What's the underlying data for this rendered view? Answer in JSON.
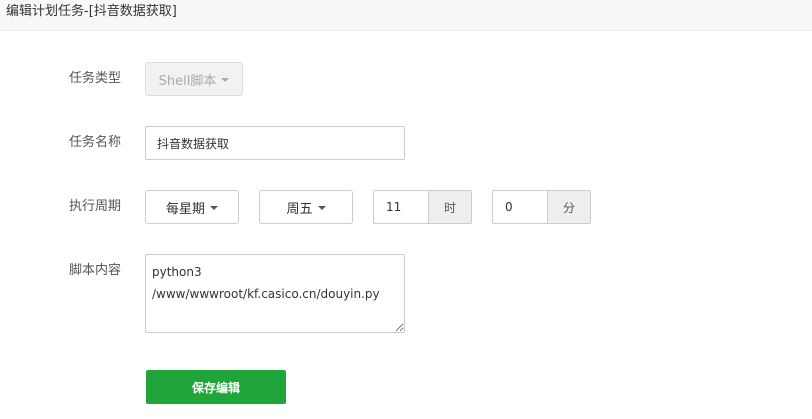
{
  "dialog": {
    "title": "编辑计划任务-[抖音数据获取]"
  },
  "form": {
    "task_type": {
      "label": "任务类型",
      "value": "Shell脚本"
    },
    "task_name": {
      "label": "任务名称",
      "value": "抖音数据获取"
    },
    "period": {
      "label": "执行周期",
      "cycle": "每星期",
      "weekday": "周五",
      "hour": "11",
      "hour_unit": "时",
      "minute": "0",
      "minute_unit": "分"
    },
    "script": {
      "label": "脚本内容",
      "value": "python3\n/www/wwwroot/kf.casico.cn/douyin.py"
    },
    "save_label": "保存编辑"
  },
  "colors": {
    "primary": "#20a53a"
  }
}
